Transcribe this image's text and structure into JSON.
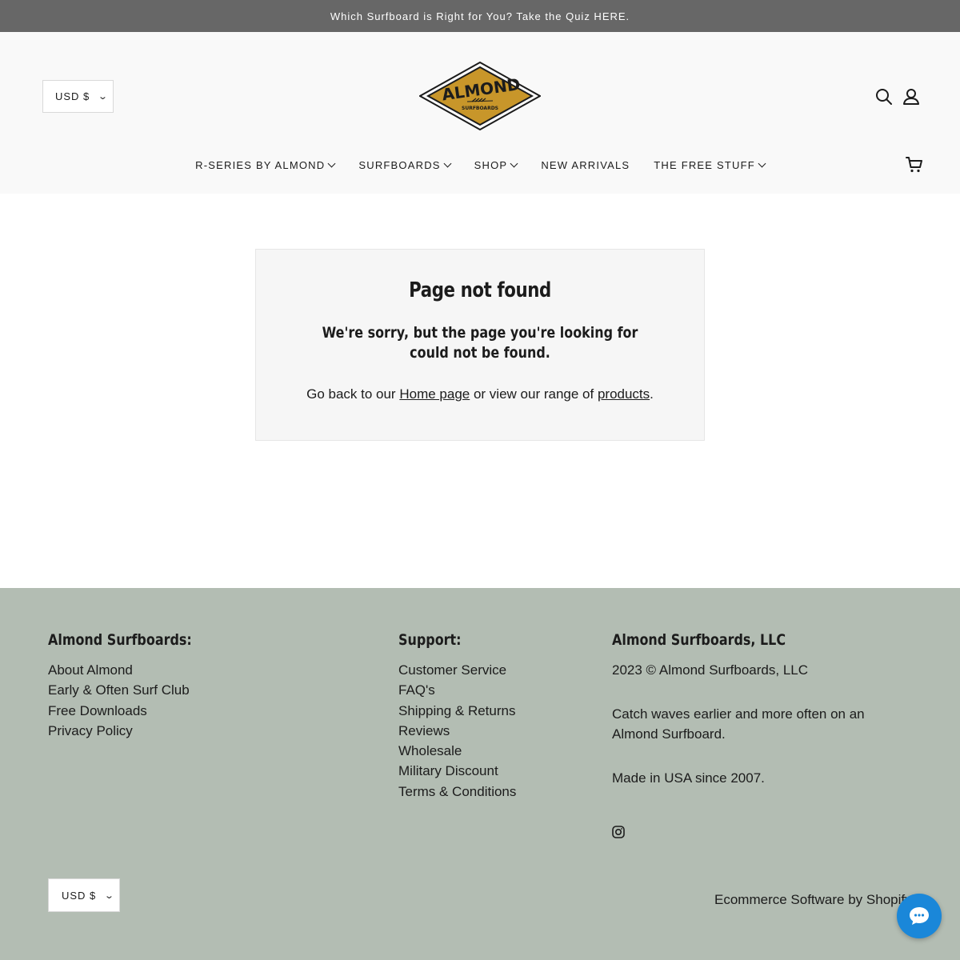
{
  "announcement": "Which Surfboard is Right for You? Take the Quiz HERE.",
  "header": {
    "currency": "USD $",
    "logo_text": "ALMOND",
    "logo_subtext": "SURFBOARDS",
    "logo_color": "#c8962a",
    "icons": [
      "search-icon",
      "account-icon",
      "cart-icon"
    ]
  },
  "nav": [
    {
      "label": "R-SERIES BY ALMOND",
      "has_dropdown": true
    },
    {
      "label": "SURFBOARDS",
      "has_dropdown": true
    },
    {
      "label": "SHOP",
      "has_dropdown": true
    },
    {
      "label": "NEW ARRIVALS",
      "has_dropdown": false
    },
    {
      "label": "THE FREE STUFF",
      "has_dropdown": true
    }
  ],
  "not_found": {
    "title": "Page not found",
    "subtitle": "We're sorry, but the page you're looking for could not be found.",
    "back_prefix": "Go back to our",
    "home_link": "Home page",
    "back_middle": "or view our range of",
    "products_link": "products",
    "back_suffix": "."
  },
  "footer": {
    "background": "#b3bdb3",
    "col1": {
      "heading": "Almond Surfboards:",
      "links": [
        "About Almond",
        "Early & Often Surf Club",
        "Free Downloads",
        "Privacy Policy"
      ]
    },
    "col2": {
      "heading": "Support:",
      "links": [
        "Customer Service",
        "FAQ's",
        "Shipping & Returns",
        "Reviews",
        "Wholesale",
        "Military Discount",
        "Terms & Conditions"
      ]
    },
    "col3": {
      "heading": "Almond Surfboards, LLC",
      "copyright": "2023 © Almond Surfboards, LLC",
      "tagline": "Catch waves earlier and more often on an Almond Surfboard.",
      "made_in": "Made in USA since 2007."
    },
    "social_icon": "instagram-icon",
    "currency": "USD $",
    "powered_by": "Ecommerce Software by Shopify"
  },
  "chat_widget": {
    "icon": "chat-bubble-icon",
    "color": "#1a87d9"
  }
}
